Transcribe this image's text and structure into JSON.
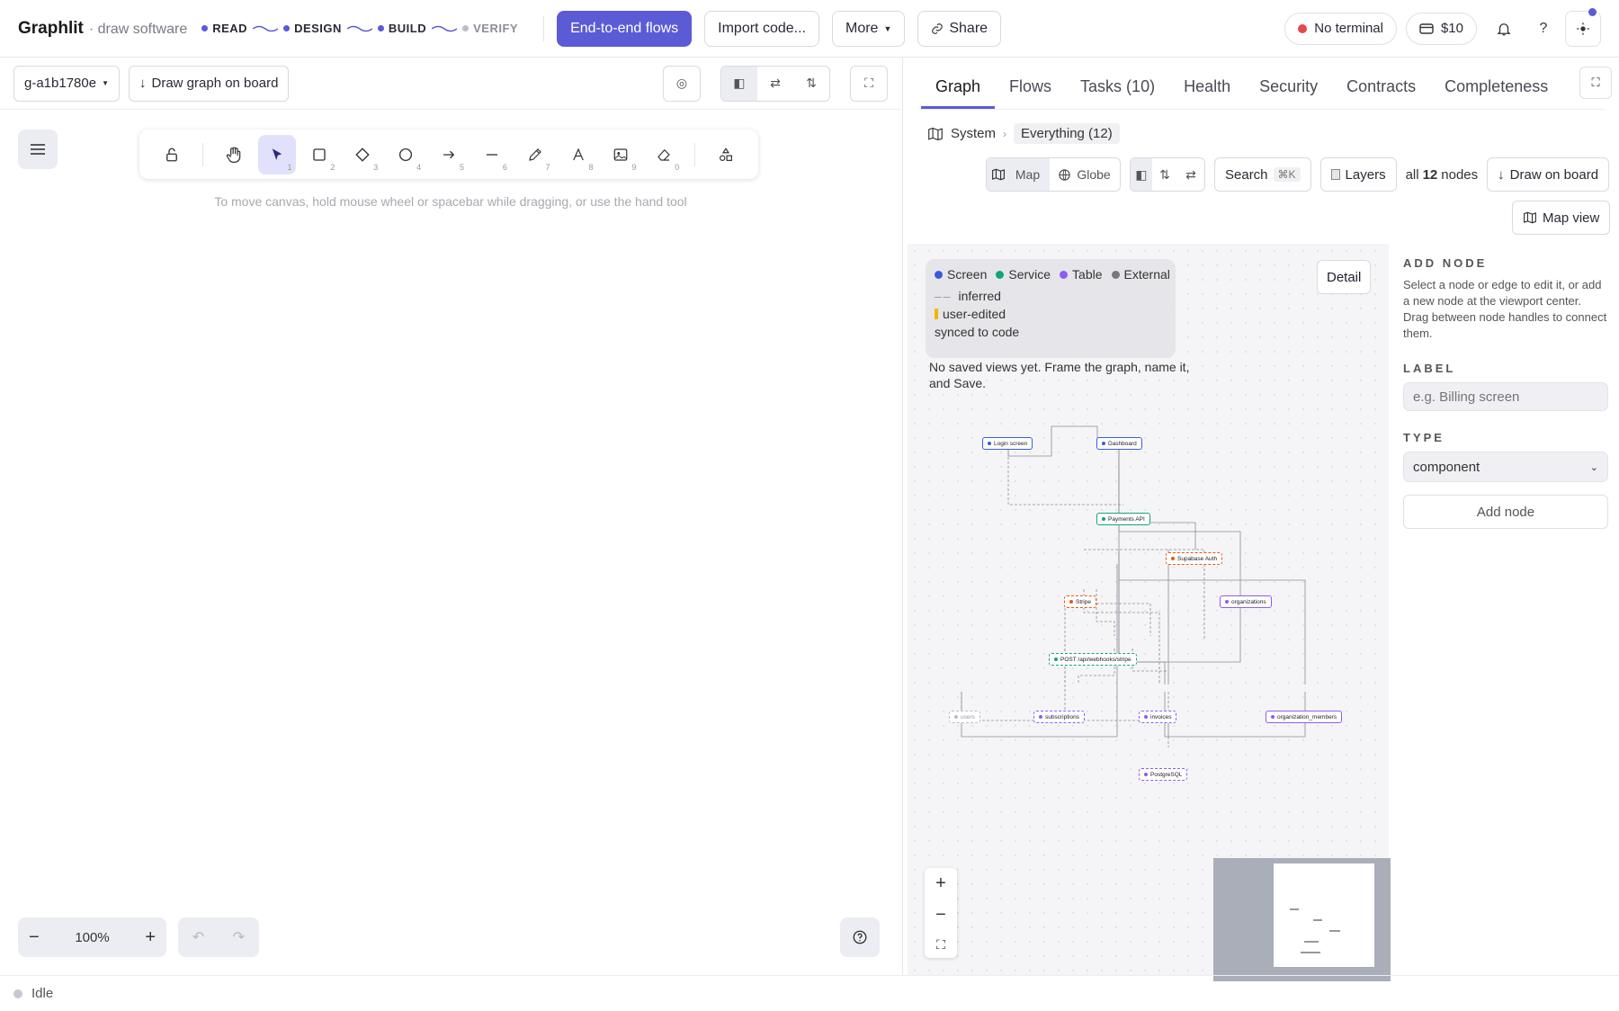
{
  "topbar": {
    "brand": "Graphlit",
    "brand_sub": "· draw software",
    "phases": [
      {
        "label": "READ",
        "active": true
      },
      {
        "label": "DESIGN",
        "active": true
      },
      {
        "label": "BUILD",
        "active": true
      },
      {
        "label": "VERIFY",
        "active": false
      }
    ],
    "flows_btn": "End-to-end flows",
    "import_btn": "Import code...",
    "more_btn": "More",
    "share_btn": "Share",
    "terminal": "No terminal",
    "credit": "$10",
    "help": "?"
  },
  "left": {
    "graph_select": "g-a1b1780e",
    "draw_btn": "Draw graph on board",
    "tools": [
      {
        "name": "lock-icon",
        "key": ""
      },
      {
        "name": "hand-icon",
        "key": ""
      },
      {
        "name": "select-arrow-icon",
        "key": "1"
      },
      {
        "name": "rectangle-icon",
        "key": "2"
      },
      {
        "name": "diamond-icon",
        "key": "3"
      },
      {
        "name": "ellipse-icon",
        "key": "4"
      },
      {
        "name": "arrow-icon",
        "key": "5"
      },
      {
        "name": "line-icon",
        "key": "6"
      },
      {
        "name": "pencil-icon",
        "key": "7"
      },
      {
        "name": "text-icon",
        "key": "8"
      },
      {
        "name": "image-icon",
        "key": "9"
      },
      {
        "name": "eraser-icon",
        "key": "0"
      },
      {
        "name": "shapes-icon",
        "key": ""
      }
    ],
    "hint": "To move canvas, hold mouse wheel or spacebar while dragging, or use the hand tool",
    "zoom": "100%"
  },
  "right": {
    "tabs": [
      "Graph",
      "Flows",
      "Tasks (10)",
      "Health",
      "Security",
      "Contracts",
      "Completeness"
    ],
    "breadcrumb_root": "System",
    "breadcrumb_current": "Everything (12)",
    "map_btn": "Map",
    "globe_btn": "Globe",
    "search_btn": "Search",
    "search_kbd": "⌘K",
    "layers_btn": "Layers",
    "count_prefix": "all",
    "count_value": "12",
    "count_suffix": "nodes",
    "draw_on_board": "Draw on board",
    "map_view": "Map view",
    "legend": {
      "types": [
        {
          "label": "Screen",
          "color": "#3b5bdb"
        },
        {
          "label": "Service",
          "color": "#12a37a"
        },
        {
          "label": "Table",
          "color": "#8b5cf6"
        },
        {
          "label": "External",
          "color": "#777780"
        }
      ],
      "inferred": "inferred",
      "user_edited": "user-edited",
      "synced": "synced to code"
    },
    "no_saved": "No saved views yet. Frame the graph, name it, and Save.",
    "detail_btn": "Detail",
    "nodes": [
      {
        "label": "Login screen",
        "color": "#3b5bdb"
      },
      {
        "label": "Dashboard",
        "color": "#3b5bdb"
      },
      {
        "label": "Payments API",
        "color": "#12a37a"
      },
      {
        "label": "Supabase Auth",
        "color": "#e8590c"
      },
      {
        "label": "organizations",
        "color": "#8b5cf6"
      },
      {
        "label": "Stripe",
        "color": "#e8590c"
      },
      {
        "label": "POST /api/webhooks/stripe",
        "color": "#12a37a"
      },
      {
        "label": "users",
        "color": "#bbbbc4"
      },
      {
        "label": "subscriptions",
        "color": "#8b5cf6"
      },
      {
        "label": "invoices",
        "color": "#8b5cf6"
      },
      {
        "label": "organization_members",
        "color": "#8b5cf6"
      },
      {
        "label": "PostgreSQL",
        "color": "#8b5cf6"
      }
    ],
    "side": {
      "add_title": "ADD NODE",
      "add_desc": "Select a node or edge to edit it, or add a new node at the viewport center. Drag between node handles to connect them.",
      "label_title": "LABEL",
      "label_placeholder": "e.g. Billing screen",
      "type_title": "TYPE",
      "type_value": "component",
      "add_btn": "Add node"
    }
  },
  "status": "Idle"
}
